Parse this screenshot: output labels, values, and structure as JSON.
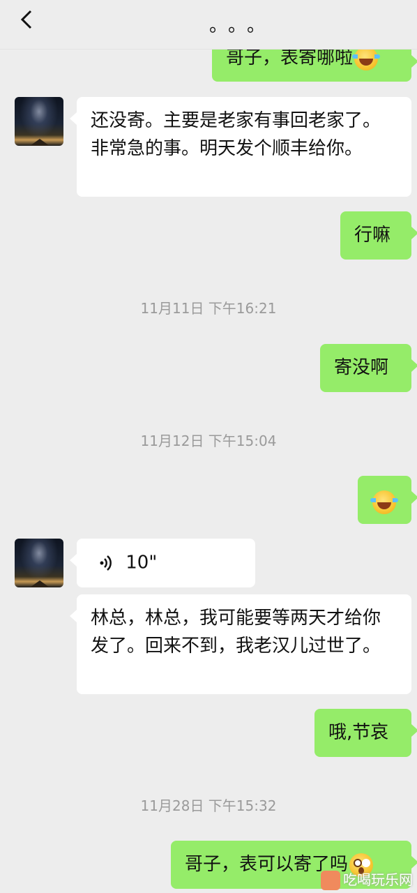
{
  "header": {
    "title": "。。。"
  },
  "messages": {
    "m1": "哥子，表寄哪啦",
    "m2": "还没寄。主要是老家有事回老家了。非常急的事。明天发个顺丰给你。",
    "m3": "行嘛",
    "t1": "11月11日 下午16:21",
    "m4": "寄没啊",
    "t2": "11月12日 下午15:04",
    "voice_duration": "10\"",
    "m6": "林总，林总，我可能要等两天才给你发了。回来不到，我老汉儿过世了。",
    "m7": "哦,节哀",
    "t3": "11月28日 下午15:32",
    "m8": "哥子，表可以寄了吗"
  },
  "icons": {
    "back": "chevron-left-icon",
    "laugh_emoji": "tears-of-joy-emoji-icon",
    "surprise_emoji": "surprised-emoji-icon",
    "voice": "voice-wave-icon"
  },
  "colors": {
    "my_bubble": "#95ec69",
    "their_bubble": "#ffffff",
    "background": "#ededed"
  },
  "watermark": {
    "text": "吃喝玩乐网"
  }
}
